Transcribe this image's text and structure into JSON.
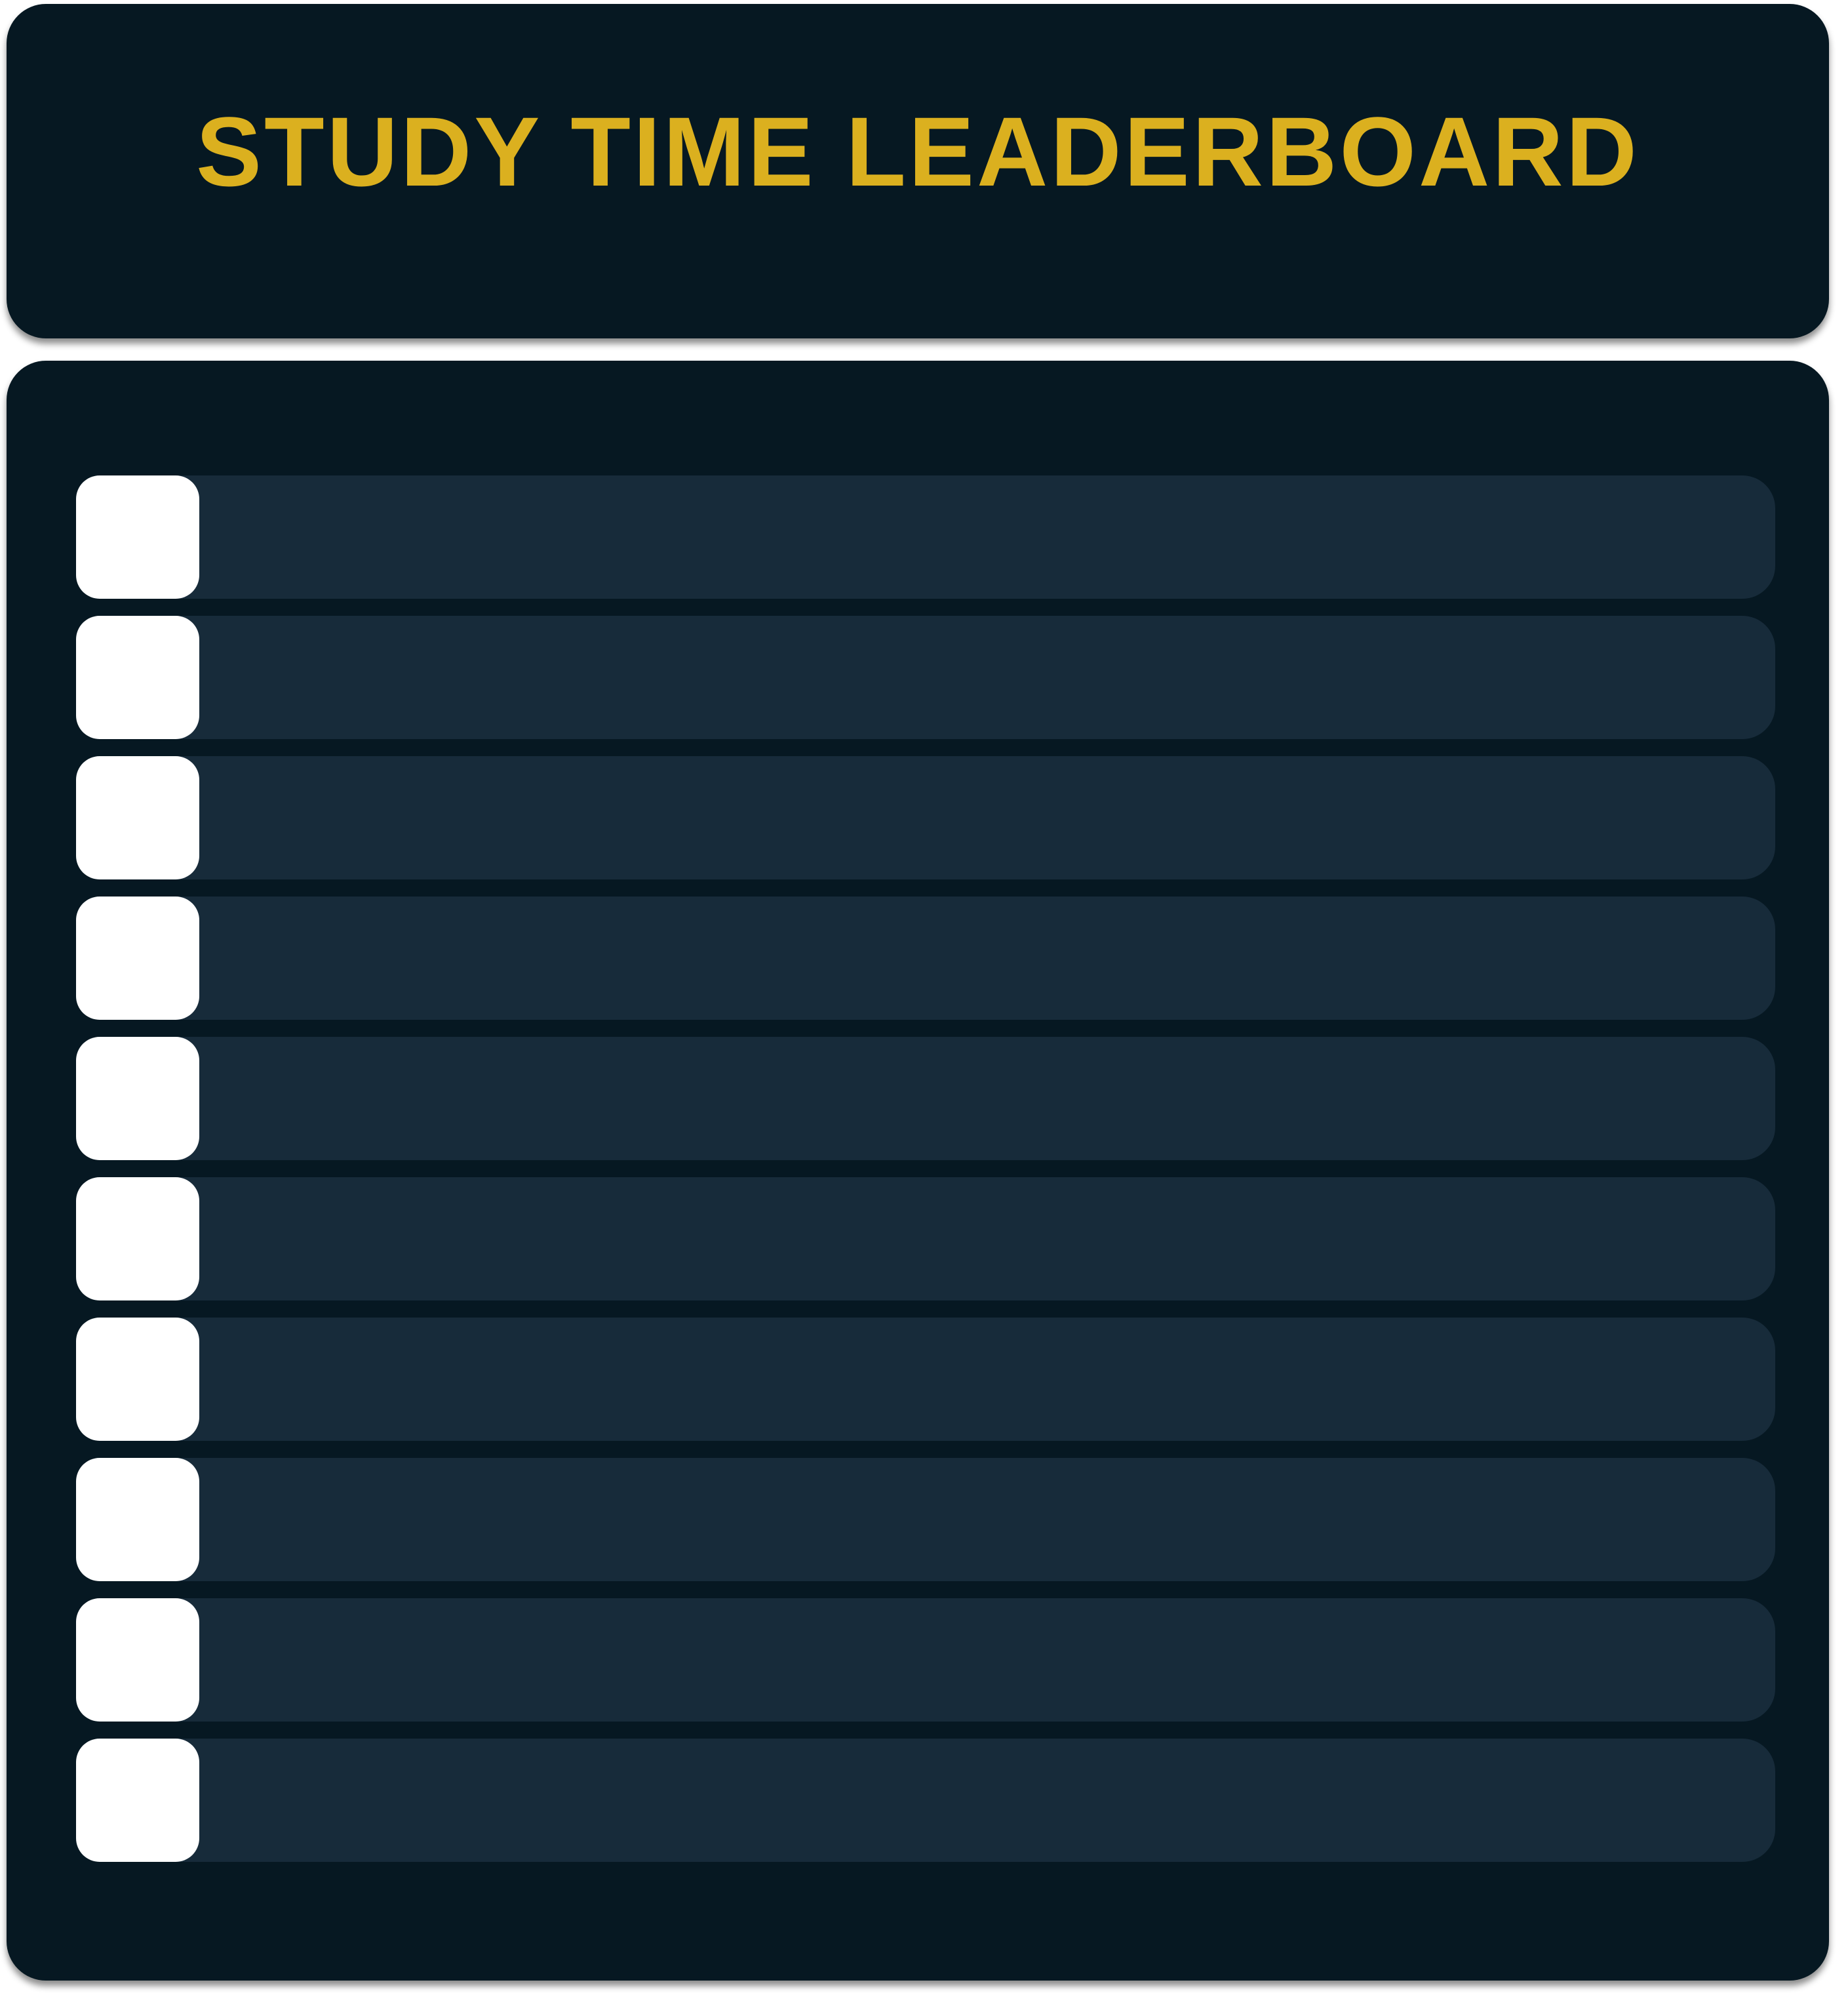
{
  "colors": {
    "panel_bg": "#061822",
    "row_bg": "#172b3a",
    "title_color": "#dbb01f",
    "rank_box": "#ffffff"
  },
  "header": {
    "title": "STUDY TIME LEADERBOARD"
  },
  "leaderboard": {
    "rows": [
      {
        "rank": "",
        "name": "",
        "time": ""
      },
      {
        "rank": "",
        "name": "",
        "time": ""
      },
      {
        "rank": "",
        "name": "",
        "time": ""
      },
      {
        "rank": "",
        "name": "",
        "time": ""
      },
      {
        "rank": "",
        "name": "",
        "time": ""
      },
      {
        "rank": "",
        "name": "",
        "time": ""
      },
      {
        "rank": "",
        "name": "",
        "time": ""
      },
      {
        "rank": "",
        "name": "",
        "time": ""
      },
      {
        "rank": "",
        "name": "",
        "time": ""
      },
      {
        "rank": "",
        "name": "",
        "time": ""
      }
    ]
  }
}
